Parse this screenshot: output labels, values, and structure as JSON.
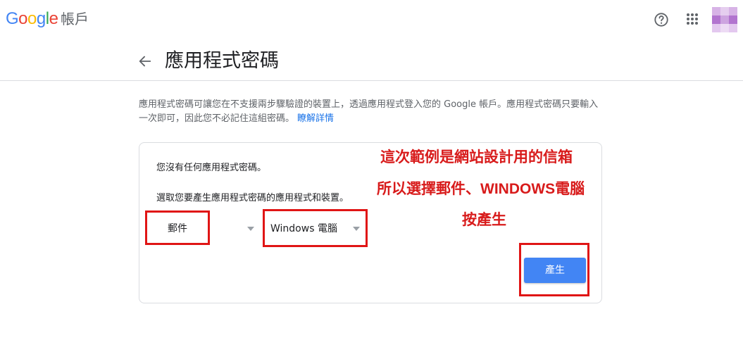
{
  "header": {
    "logo_letters": [
      "G",
      "o",
      "o",
      "g",
      "l",
      "e"
    ],
    "product_name": "帳戶",
    "icons": {
      "help": "help-circle-icon",
      "apps": "apps-grid-icon",
      "avatar": "account-avatar"
    },
    "colors": {
      "blue": "#4285f4",
      "red": "#ea4335",
      "yellow": "#fbbc05",
      "green": "#34a853"
    }
  },
  "page": {
    "title": "應用程式密碼",
    "back_icon": "arrow-back-icon",
    "description": "應用程式密碼可讓您在不支援兩步驟驗證的裝置上，透過應用程式登入您的 Google 帳戶。應用程式密碼只要輸入一次即可，因此您不必記住這組密碼。",
    "learn_more": "瞭解詳情",
    "link_color": "#1a73e8"
  },
  "card": {
    "no_passwords": "您沒有任何應用程式密碼。",
    "select_prompt": "選取您要產生應用程式密碼的應用程式和裝置。",
    "app_select": {
      "value": "郵件",
      "icon": "dropdown-caret-icon"
    },
    "device_select": {
      "value": "Windows 電腦",
      "icon": "dropdown-caret-icon"
    },
    "generate_label": "產生",
    "button_color": "#4285f4"
  },
  "annotations": {
    "line1": "這次範例是網站設計用的信箱",
    "line2": "所以選擇郵件、WINDOWS電腦",
    "line3": "按產生",
    "color": "#d81b1b"
  }
}
